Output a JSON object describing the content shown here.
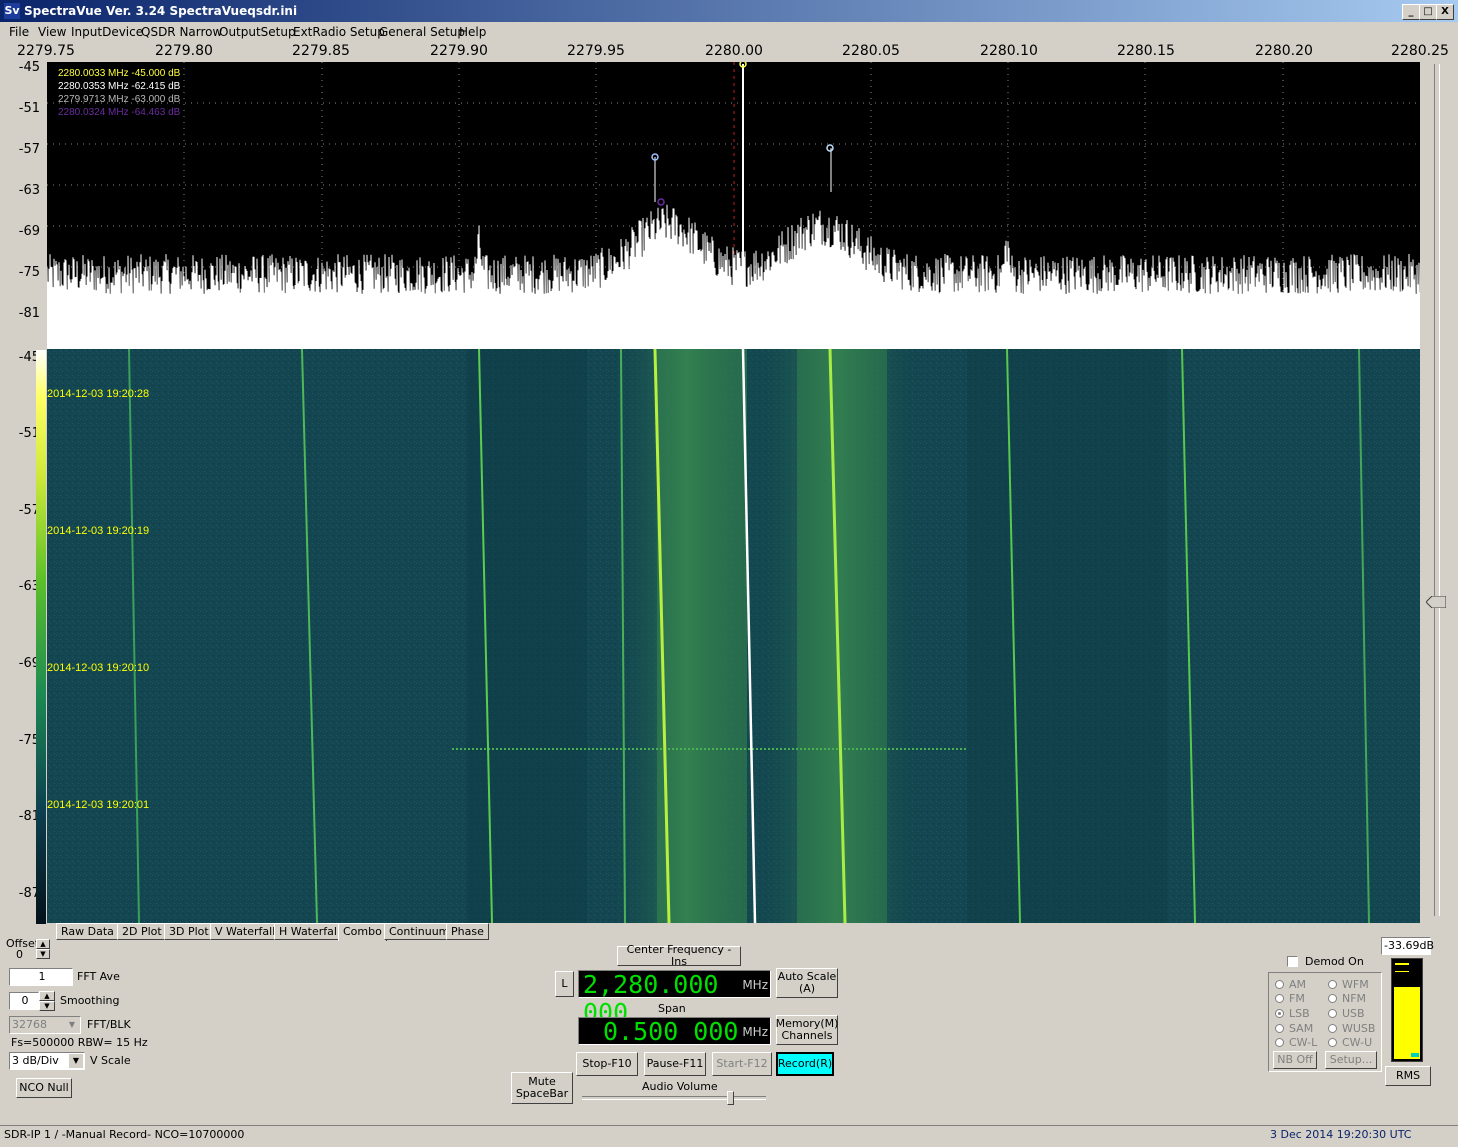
{
  "window": {
    "title": "SpectraVue Ver. 3.24  SpectraVueqsdr.ini",
    "icon": "spectravue-app-icon",
    "buttons": [
      "_",
      "□",
      "X"
    ]
  },
  "menu": [
    "File",
    "View",
    "InputDevice",
    "QSDR Narrow",
    "OutputSetup",
    "ExtRadio Setup",
    "General Setup",
    "Help"
  ],
  "freq_axis": [
    "2279.75",
    "2279.80",
    "2279.85",
    "2279.90",
    "2279.95",
    "2280.00",
    "2280.05",
    "2280.10",
    "2280.15",
    "2280.20",
    "2280.25"
  ],
  "spectrum_db_axis": [
    "-45",
    "-51",
    "-57",
    "-63",
    "-69",
    "-75",
    "-81"
  ],
  "waterfall_db_axis": [
    "-45",
    "-51",
    "-57",
    "-63",
    "-69",
    "-75",
    "-81",
    "-87"
  ],
  "markers": [
    {
      "text": "2280.0033 MHz  -45.000 dB",
      "color": "#ffff40"
    },
    {
      "text": "2280.0353 MHz  -62.415 dB",
      "color": "#ffffff"
    },
    {
      "text": "2279.9713 MHz  -63.000 dB",
      "color": "#b8b8b8"
    },
    {
      "text": "2280.0324 MHz  -64.463 dB",
      "color": "#6a2ca0"
    }
  ],
  "timestamps": [
    "2014-12-03 19:20:28",
    "2014-12-03 19:20:19",
    "2014-12-03 19:20:10",
    "2014-12-03 19:20:01"
  ],
  "tabs": [
    "Raw Data",
    "2D Plot",
    "3D Plot",
    "V Waterfall",
    "H Waterfall",
    "Combo",
    "Continuum",
    "Phase"
  ],
  "controls": {
    "offset_label": "Offset",
    "offset_value": "0",
    "fft_ave_value": "1",
    "fft_ave_label": "FFT Ave",
    "smoothing_value": "0",
    "smoothing_label": "Smoothing",
    "fft_blk_value": "32768",
    "fft_blk_label": "FFT/BLK",
    "fs_rbw": "Fs=500000 RBW=  15 Hz",
    "vscale_value": "3 dB/Div",
    "vscale_label": "V Scale",
    "nco_null": "NCO Null"
  },
  "center": {
    "center_freq_button": "Center Frequency - Ins",
    "l_button": "L",
    "center_freq_value": "2,280.000 000",
    "center_freq_unit": "MHz",
    "auto_scale": "Auto Scale (A)",
    "span_label": "Span",
    "span_value": "0.500 000",
    "span_unit": "MHz",
    "memory": "Memory(M) Channels",
    "stop": "Stop-F10",
    "pause": "Pause-F11",
    "start": "Start-F12",
    "record": "Record(R)",
    "mute": "Mute SpaceBar",
    "audio_volume": "Audio Volume"
  },
  "demod": {
    "checkbox_label": "Demod On",
    "modes_left": [
      "AM",
      "FM",
      "LSB",
      "SAM",
      "CW-L"
    ],
    "modes_right": [
      "WFM",
      "NFM",
      "USB",
      "WUSB",
      "CW-U"
    ],
    "selected": "LSB",
    "nb_off": "NB Off",
    "setup": "Setup..."
  },
  "level": {
    "value": "-33.69dB",
    "rms": "RMS",
    "fill_fraction": 0.75
  },
  "status": {
    "left": "SDR-IP 1  / -Manual Record-   NCO=10700000",
    "right": "3 Dec 2014  19:20:30 UTC"
  },
  "colors": {
    "trace": "#ffffff",
    "waterfall_bg": "#13474f",
    "signal": "#9cf040",
    "timestamp": "#ffff00",
    "record_btn": "#00ffff",
    "digits": "#00e000",
    "meter_fill": "#ffff00"
  }
}
